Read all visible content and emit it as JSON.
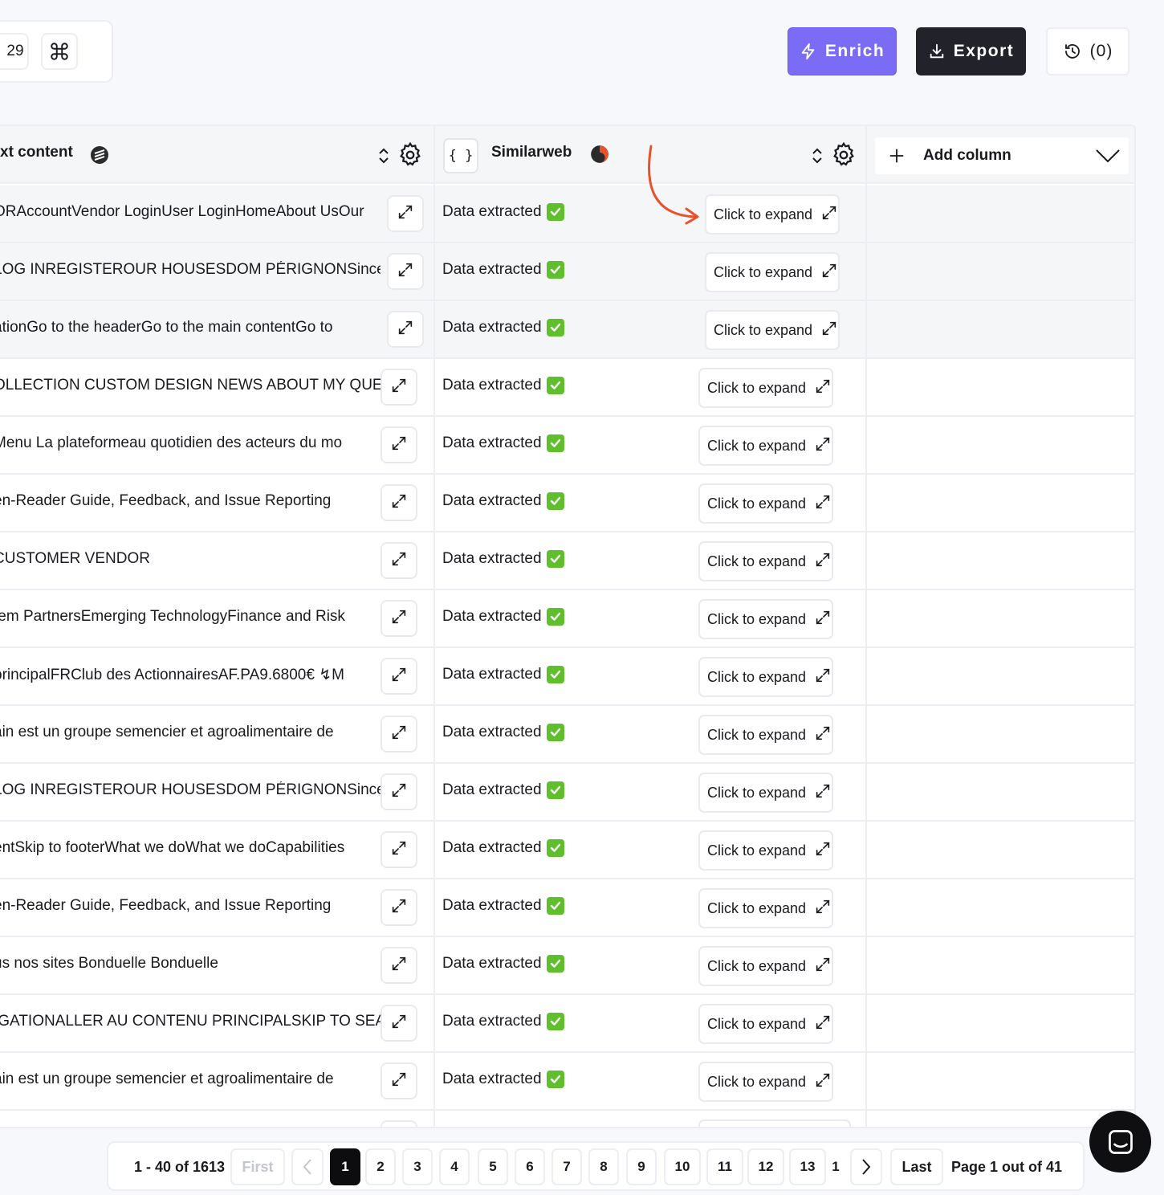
{
  "toolbar": {
    "row_count": "29",
    "enrich_label": "Enrich",
    "export_label": "Export",
    "history_label": "(0)"
  },
  "columns": {
    "text_content": "xt content",
    "similarweb": "Similarweb",
    "json_badge": "{ }",
    "add_column": "Add column"
  },
  "rows": [
    {
      "text": "ORAccountVendor LoginUser LoginHomeAbout UsOur",
      "status": "Data extracted",
      "action": "Click to expand"
    },
    {
      "text": "LOG INREGISTEROUR HOUSESDOM PÉRIGNONSince",
      "status": "Data extracted",
      "action": "Click to expand"
    },
    {
      "text": "ationGo to the headerGo to the main contentGo to",
      "status": "Data extracted",
      "action": "Click to expand"
    },
    {
      "text": "OLLECTION  CUSTOM DESIGN NEWS ABOUT MY QUEUE",
      "status": "Data extracted",
      "action": "Click to expand"
    },
    {
      "text": "Menu La plateformeau quotidien des acteurs du mo",
      "status": "Data extracted",
      "action": "Click to expand"
    },
    {
      "text": "en-Reader Guide, Feedback, and Issue Reporting",
      "status": "Data extracted",
      "action": "Click to expand"
    },
    {
      "text": "                        CUSTOMER      VENDOR",
      "status": "Data extracted",
      "action": "Click to expand"
    },
    {
      "text": "tem PartnersEmerging TechnologyFinance and Risk",
      "status": "Data extracted",
      "action": "Click to expand"
    },
    {
      "text": "principalFRClub des ActionnairesAF.PA9.6800€ ↯M",
      "status": "Data extracted",
      "action": "Click to expand"
    },
    {
      "text": "ain est un groupe semencier et agroalimentaire de",
      "status": "Data extracted",
      "action": "Click to expand"
    },
    {
      "text": "LOG INREGISTEROUR HOUSESDOM PÉRIGNONSince",
      "status": "Data extracted",
      "action": "Click to expand"
    },
    {
      "text": "entSkip to footerWhat we doWhat we doCapabilities",
      "status": "Data extracted",
      "action": "Click to expand"
    },
    {
      "text": "en-Reader Guide, Feedback, and Issue Reporting",
      "status": "Data extracted",
      "action": "Click to expand"
    },
    {
      "text": "us nos sites                      Bonduelle                Bonduelle",
      "status": "Data extracted",
      "action": "Click to expand"
    },
    {
      "text": "IGATIONALLER AU CONTENU PRINCIPALSKIP TO SEARCH",
      "status": "Data extracted",
      "action": "Click to expand"
    },
    {
      "text": "ain est un groupe semencier et agroalimentaire de",
      "status": "Data extracted",
      "action": "Click to expand"
    }
  ],
  "pagination": {
    "range": "1 - 40 of 1613",
    "first": "First",
    "last": "Last",
    "pages": [
      "1",
      "2",
      "3",
      "4",
      "5",
      "6",
      "7",
      "8",
      "9",
      "10",
      "11",
      "12",
      "13",
      "1"
    ],
    "info": "Page 1 out of 41"
  },
  "colors": {
    "enrich": "#7b6cf6",
    "export": "#22232a",
    "check": "#5fbf2c",
    "arrow": "#e8512e"
  }
}
